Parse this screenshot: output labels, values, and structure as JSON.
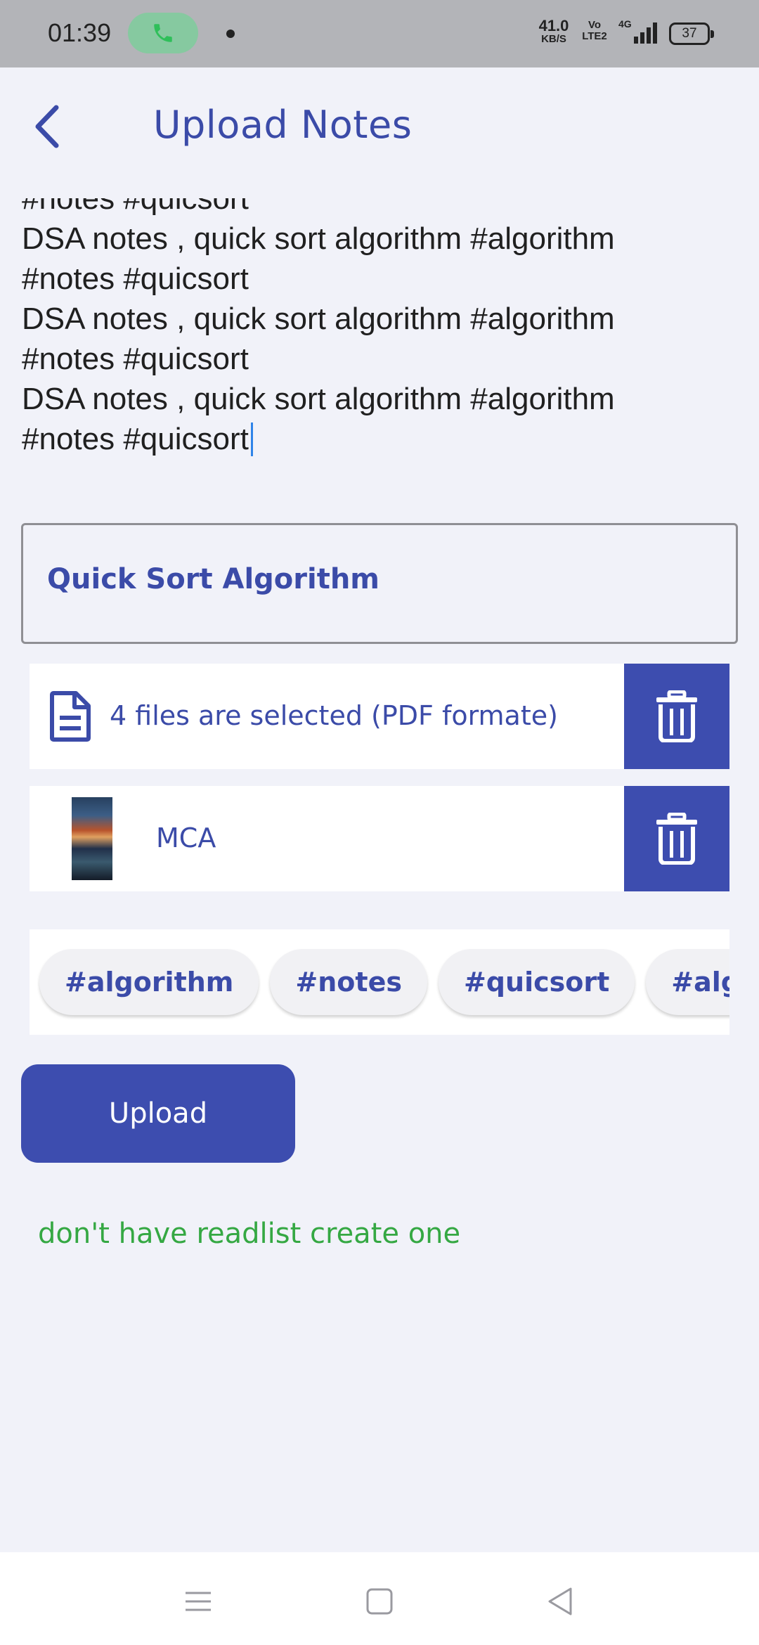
{
  "status_bar": {
    "time": "01:39",
    "net_speed_value": "41.0",
    "net_speed_unit": "KB/S",
    "volte_line1": "Vo",
    "volte_line2": "LTE2",
    "signal_label": "4G",
    "battery": "37"
  },
  "app_bar": {
    "title": "Upload Notes"
  },
  "description": {
    "text": "#notes #quicsort\nDSA notes , quick sort algorithm #algorithm\n#notes #quicsort\nDSA notes , quick sort algorithm #algorithm\n#notes #quicsort\nDSA notes , quick sort algorithm #algorithm\n#notes #quicsort"
  },
  "title_field": {
    "value": "Quick Sort Algorithm"
  },
  "files": {
    "selected_label": "4 files are selected (PDF formate)",
    "readlist_label": "MCA"
  },
  "tags": [
    "#algorithm",
    "#notes",
    "#quicsort",
    "#algorithm"
  ],
  "actions": {
    "upload_label": "Upload",
    "create_readlist_label": "don't have readlist create one"
  },
  "colors": {
    "primary": "#3d4daf",
    "text_primary": "#3b4ba8",
    "link_green": "#35a843",
    "background": "#f1f2f9"
  },
  "icons": {
    "back": "chevron-left-icon",
    "document": "document-icon",
    "delete": "trash-icon",
    "call": "phone-icon",
    "nav_menu": "menu-icon",
    "nav_home": "square-home-icon",
    "nav_back": "triangle-back-icon"
  }
}
